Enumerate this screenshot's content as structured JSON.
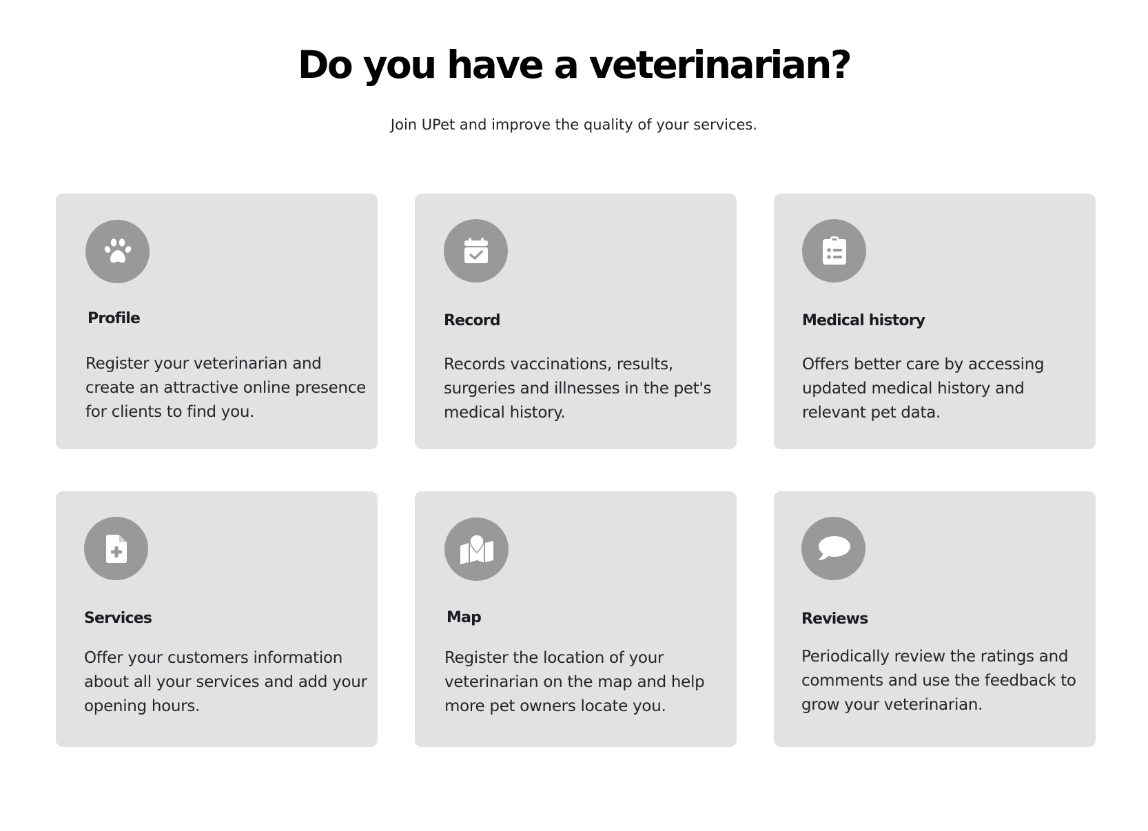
{
  "header": {
    "title": "Do you have a veterinarian?",
    "subtitle": "Join UPet and improve the quality of your services."
  },
  "colors": {
    "card_background": "#e2e2e2",
    "icon_circle": "#999999",
    "icon_glyph": "#ffffff"
  },
  "features": [
    {
      "icon": "paw-icon",
      "title": "Profile",
      "description": "Register your veterinarian and create an attractive online presence for clients to find you."
    },
    {
      "icon": "calendar-check-icon",
      "title": "Record",
      "description": "Records vaccinations, results, surgeries and illnesses in the pet's medical history."
    },
    {
      "icon": "clipboard-list-icon",
      "title": "Medical history",
      "description": "Offers better care by accessing updated medical history and relevant pet data."
    },
    {
      "icon": "file-medical-icon",
      "title": "Services",
      "description": "Offer your customers information about all your services and add your opening hours."
    },
    {
      "icon": "map-location-icon",
      "title": "Map",
      "description": "Register the location of your veterinarian on the map and help more pet owners locate you."
    },
    {
      "icon": "comment-icon",
      "title": "Reviews",
      "description": "Periodically review the ratings and comments and use the feedback to grow your veterinarian."
    }
  ]
}
